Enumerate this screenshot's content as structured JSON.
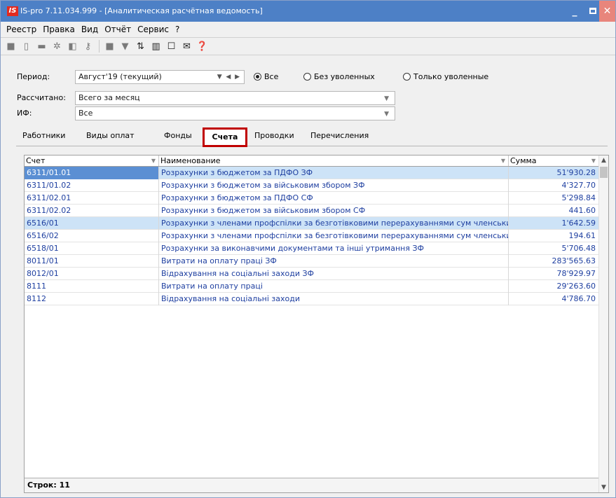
{
  "window": {
    "logo": "IS",
    "title": "IS-pro 7.11.034.999 - [Аналитическая расчётная ведомость]",
    "min_label": "_",
    "close_label": "✕"
  },
  "menu": [
    "Реестр",
    "Правка",
    "Вид",
    "Отчёт",
    "Сервис",
    "?"
  ],
  "filters": {
    "period_label": "Период:",
    "period_value": "Август'19 (текущий)",
    "radio_all": "Все",
    "radio_no_fired": "Без уволенных",
    "radio_only_fired": "Только уволенные",
    "calc_label": "Рассчитано:",
    "calc_value": "Всего за месяц",
    "if_label": "ИФ:",
    "if_value": "Все"
  },
  "tabs": [
    "Работники",
    "Виды оплат",
    "Фонды",
    "Счета",
    "Проводки",
    "Перечисления"
  ],
  "grid": {
    "headers": [
      "Счет",
      "Наименование",
      "Сумма"
    ],
    "rows": [
      {
        "account": "6311/01.01",
        "name": "Розрахунки з бюджетом за ПДФО ЗФ",
        "sum": "51'930.28"
      },
      {
        "account": "6311/01.02",
        "name": "Розрахунки з бюджетом за  військовим збором ЗФ",
        "sum": "4'327.70"
      },
      {
        "account": "6311/02.01",
        "name": "Розрахунки з бюджетом за ПДФО СФ",
        "sum": "5'298.84"
      },
      {
        "account": "6311/02.02",
        "name": "Розрахунки з бюджетом за  військовим збором СФ",
        "sum": "441.60"
      },
      {
        "account": "6516/01",
        "name": "Розрахунки з членами профспілки за безготівковими перерахуваннями сум членських проф…",
        "sum": "1'642.59"
      },
      {
        "account": "6516/02",
        "name": "Розрахунки з членами профспілки за безготівковими перерахуваннями сум членських проф…",
        "sum": "194.61"
      },
      {
        "account": "6518/01",
        "name": "Розрахунки за виконавчими документами та інші утримання ЗФ",
        "sum": "5'706.48"
      },
      {
        "account": "8011/01",
        "name": "Витрати на оплату праці ЗФ",
        "sum": "283'565.63"
      },
      {
        "account": "8012/01",
        "name": "Відрахування на соціальні заходи ЗФ",
        "sum": "78'929.97"
      },
      {
        "account": "8111",
        "name": "Витрати на оплату праці",
        "sum": "29'263.60"
      },
      {
        "account": "8112",
        "name": "Відрахування на соціальні заходи",
        "sum": "4'786.70"
      }
    ],
    "footer": "Строк: 11"
  }
}
